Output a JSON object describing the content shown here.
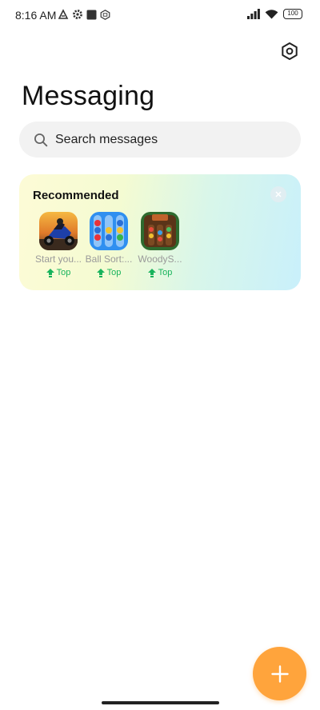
{
  "status_bar": {
    "time": "8:16 AM",
    "battery": "100",
    "left_icons": [
      "notification-icon",
      "gear-icon",
      "square-icon",
      "app-icon"
    ],
    "right_icons": [
      "signal-icon",
      "wifi-icon",
      "battery-icon"
    ]
  },
  "header": {
    "title": "Messaging",
    "settings_icon": "settings-hexagon-icon"
  },
  "search": {
    "placeholder": "Search messages"
  },
  "recommended": {
    "title": "Recommended",
    "apps": [
      {
        "name": "Start you...",
        "badge": "Top"
      },
      {
        "name": "Ball Sort:...",
        "badge": "Top"
      },
      {
        "name": "WoodyS...",
        "badge": "Top"
      }
    ]
  },
  "colors": {
    "accent": "#ffa43c",
    "badge_green": "#18b35c",
    "search_bg": "#f2f2f2"
  },
  "fab": {
    "icon": "plus-icon"
  }
}
